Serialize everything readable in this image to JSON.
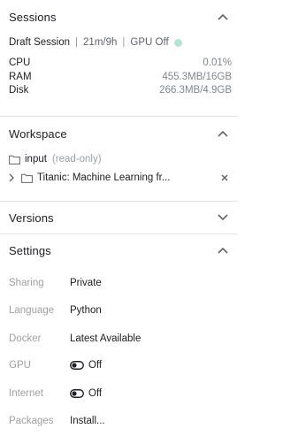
{
  "sessions": {
    "title": "Sessions",
    "session_name": "Draft Session",
    "run_time": "21m/9h",
    "gpu_status": "GPU Off",
    "status_color": "#b6e3d5",
    "stats": [
      {
        "label": "CPU",
        "value": "0.01%"
      },
      {
        "label": "RAM",
        "value": "455.3MB/16GB"
      },
      {
        "label": "Disk",
        "value": "266.3MB/4.9GB"
      }
    ]
  },
  "workspace": {
    "title": "Workspace",
    "input_folder": "input",
    "input_note": "(read-only)",
    "dataset_name": "Titanic: Machine Learning fr..."
  },
  "versions": {
    "title": "Versions"
  },
  "settings": {
    "title": "Settings",
    "rows": [
      {
        "label": "Sharing",
        "value": "Private"
      },
      {
        "label": "Language",
        "value": "Python"
      },
      {
        "label": "Docker",
        "value": "Latest Available"
      },
      {
        "label": "GPU",
        "value": "Off"
      },
      {
        "label": "Internet",
        "value": "Off"
      },
      {
        "label": "Packages",
        "value": "Install..."
      }
    ]
  }
}
